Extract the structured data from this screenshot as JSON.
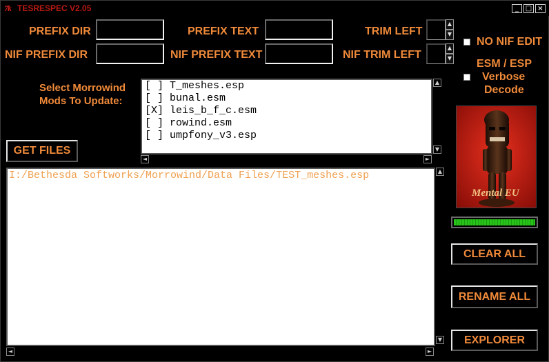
{
  "window": {
    "title": "TESRESPEC V2.05",
    "app_icon": "tk-feather-icon",
    "minimize_glyph": "_",
    "maximize_glyph": "□",
    "close_glyph": "×"
  },
  "labels": {
    "prefix_dir": "PREFIX DIR",
    "prefix_text": "PREFIX TEXT",
    "trim_left": "TRIM LEFT",
    "nif_prefix_dir": "NIF PREFIX DIR",
    "nif_prefix_text": "NIF PREFIX TEXT",
    "nif_trim_left": "NIF TRIM LEFT",
    "no_nif_edit": "NO NIF EDIT",
    "esm_esp_line1": "ESM / ESP",
    "esm_esp_line2": "Verbose",
    "esm_esp_line3": "Decode",
    "select_mods_line1": "Select Morrowind",
    "select_mods_line2": "Mods To Update:"
  },
  "inputs": {
    "prefix_dir": "",
    "prefix_text": "",
    "trim_left": "",
    "nif_prefix_dir": "",
    "nif_prefix_text": "",
    "nif_trim_left": ""
  },
  "mods": [
    "[ ] T_meshes.esp",
    "[ ] bunal.esm",
    "[X] leis_b_f_c.esm",
    "[ ] rowind.esm",
    "[ ] umpfony_v3.esp"
  ],
  "buttons": {
    "get_files": "GET FILES",
    "clear_all": "CLEAR ALL",
    "rename_all": "RENAME ALL",
    "explorer": "EXPLORER"
  },
  "console_lines": [
    "I:/Bethesda Softworks/Morrowind/Data Files/TEST_meshes.esp"
  ],
  "image_caption": "Mental EU",
  "progress_fraction": 1.0,
  "colors": {
    "label_orange": "#f08a3a",
    "title_red": "#b81a12",
    "progress_green": "#29c41a"
  },
  "icons": {
    "spin_up": "▲",
    "spin_down": "▼",
    "scroll_up": "▲",
    "scroll_down": "▼",
    "scroll_left": "◄",
    "scroll_right": "►"
  }
}
